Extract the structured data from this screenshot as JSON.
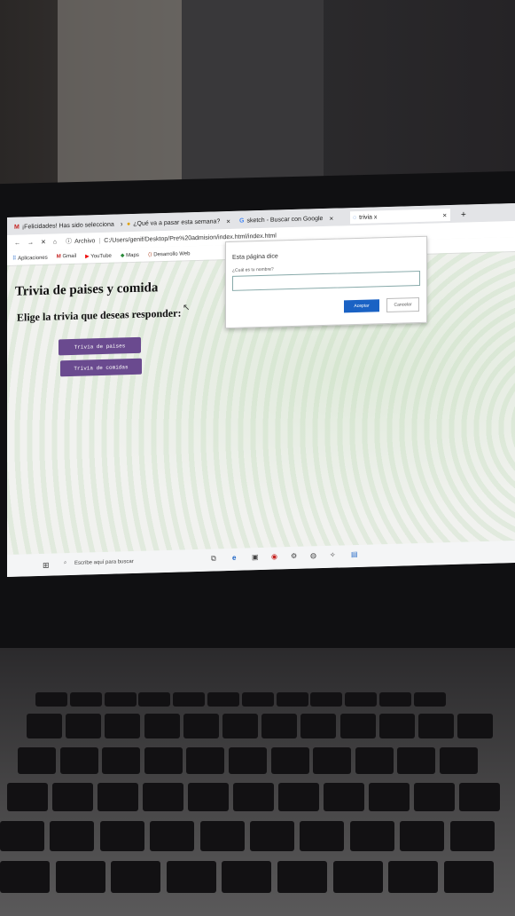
{
  "browser": {
    "tabs": [
      {
        "icon": "gmail-icon",
        "label": "¡Felicidades! Has sido selecciona",
        "close": "×"
      },
      {
        "icon": "emoji-icon",
        "label": "¿Qué va a pasar esta semana?",
        "close": "×"
      },
      {
        "icon": "google-icon",
        "label": "sketch - Buscar con Google",
        "close": "×"
      },
      {
        "icon": "loading-icon",
        "label": "trivia x",
        "close": "×"
      }
    ],
    "new_tab": "+",
    "address": {
      "prefix": "Archivo",
      "url": "C:/Users/genif/Desktop/Pre%20admision/index.html/index.html"
    },
    "bookmarks": [
      "Aplicaciones",
      "Gmail",
      "YouTube",
      "Maps",
      "Desarrollo Web"
    ]
  },
  "page": {
    "title": "Trivia de paises y comida",
    "subtitle": "Elige la trivia que deseas responder:",
    "buttons": [
      "Trivia de paises",
      "Trivia de comidas"
    ]
  },
  "dialog": {
    "title": "Esta página dice",
    "question": "¿Cuál es tu nombre?",
    "input_value": "",
    "ok_label": "Aceptar",
    "cancel_label": "Cancelar"
  },
  "taskbar": {
    "search_placeholder": "Escribe aquí para buscar"
  },
  "colors": {
    "button_purple": "#6a4a8f",
    "dialog_ok_blue": "#1a62c4"
  }
}
